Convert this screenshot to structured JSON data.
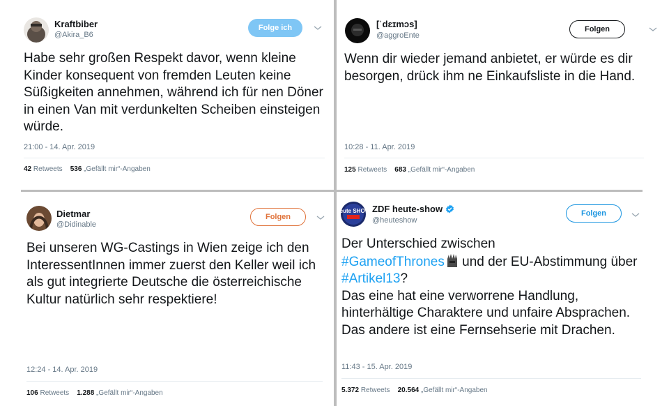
{
  "tweets": [
    {
      "name": "Kraftbiber",
      "handle": "@Akira_B6",
      "follow_label": "Folge ich",
      "follow_state": "following",
      "text": "Habe sehr großen Respekt davor, wenn kleine Kinder konsequent von fremden Leuten keine Süßigkeiten annehmen, während ich für nen Döner in einen Van mit verdunkelten Scheiben einsteigen würde.",
      "time": "21:00 - 14. Apr. 2019",
      "retweets": "42",
      "retweets_label": "Retweets",
      "likes": "536",
      "likes_label": "„Gefällt mir“-Angaben"
    },
    {
      "name": "[ˈdɛɪmɔs]",
      "handle": "@aggroEnte",
      "follow_label": "Folgen",
      "text": "Wenn dir wieder jemand anbietet, er würde es dir besorgen, drück ihm ne Einkaufsliste in die Hand.",
      "time": "10:28 - 11. Apr. 2019",
      "retweets": "125",
      "retweets_label": "Retweets",
      "likes": "683",
      "likes_label": "„Gefällt mir“-Angaben"
    },
    {
      "name": "Dietmar",
      "handle": "@Didinable",
      "follow_label": "Folgen",
      "text": "Bei unseren WG-Castings in Wien zeige ich den InteressentInnen immer zuerst den Keller weil ich als gut integrierte Deutsche die österreichische Kultur natürlich sehr respektiere!",
      "time": "12:24 - 14. Apr. 2019",
      "retweets": "106",
      "retweets_label": "Retweets",
      "likes": "1.288",
      "likes_label": "„Gefällt mir“-Angaben"
    },
    {
      "name": "ZDF heute-show",
      "handle": "@heuteshow",
      "verified": true,
      "avatar_text": "heute SHOW",
      "follow_label": "Folgen",
      "text_line1": "Der Unterschied zwischen",
      "hashtag1": "#GameofThrones",
      "text_mid": "und der EU-Abstimmung über",
      "hashtag2": "#Artikel13",
      "text_q": "?",
      "text_line4": "Das eine hat eine verworrene Handlung, hinterhältige Charaktere und unfaire Absprachen.",
      "text_line5": "Das andere ist eine Fernsehserie mit Drachen.",
      "time": "11:43 - 15. Apr. 2019",
      "retweets": "5.372",
      "retweets_label": "Retweets",
      "likes": "20.564",
      "likes_label": "„Gefällt mir“-Angaben"
    }
  ],
  "colors": {
    "twitter_blue": "#1da1f2",
    "following_fill": "#7fc6f5",
    "follow_orange": "#e0733b",
    "divider": "#bdbdbd"
  },
  "icons": {
    "chevron": "chevron-down-icon",
    "verified": "verified-badge-icon",
    "throne": "iron-throne-emoji-icon"
  }
}
